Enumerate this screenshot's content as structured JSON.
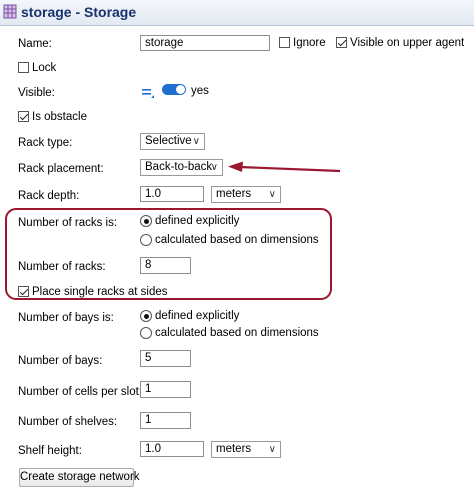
{
  "header": {
    "title": "storage - Storage",
    "icon": "storage-rack-icon"
  },
  "name": {
    "label": "Name:",
    "value": "storage"
  },
  "ignore": {
    "label": "Ignore",
    "checked": false
  },
  "visible_upper_agent": {
    "label": "Visible on upper agent",
    "checked": true
  },
  "lock": {
    "label": "Lock",
    "checked": false
  },
  "visible": {
    "label": "Visible:",
    "value": "yes",
    "toggle_on": true
  },
  "is_obstacle": {
    "label": "Is obstacle",
    "checked": true
  },
  "rack_type": {
    "label": "Rack type:",
    "value": "Selective"
  },
  "rack_placement": {
    "label": "Rack placement:",
    "value": "Back-to-back"
  },
  "rack_depth": {
    "label": "Rack depth:",
    "value": "1.0",
    "unit": "meters"
  },
  "num_racks_is": {
    "label": "Number of racks is:",
    "options": [
      "defined explicitly",
      "calculated based on dimensions"
    ],
    "selected": 0
  },
  "num_racks": {
    "label": "Number of racks:",
    "value": "8"
  },
  "place_single_racks": {
    "label": "Place single racks at sides",
    "checked": true
  },
  "num_bays_is": {
    "label": "Number of bays is:",
    "options": [
      "defined explicitly",
      "calculated based on dimensions"
    ],
    "selected": 0
  },
  "num_bays": {
    "label": "Number of bays:",
    "value": "5"
  },
  "cells_per_slot": {
    "label": "Number of cells per slot:",
    "value": "1"
  },
  "num_shelves": {
    "label": "Number of shelves:",
    "value": "1"
  },
  "shelf_height": {
    "label": "Shelf height:",
    "value": "1.0",
    "unit": "meters"
  },
  "create_button": {
    "label": "Create storage network"
  },
  "colors": {
    "title": "#16336d",
    "annotation": "#9a1730",
    "toggle": "#1f6fd0"
  }
}
